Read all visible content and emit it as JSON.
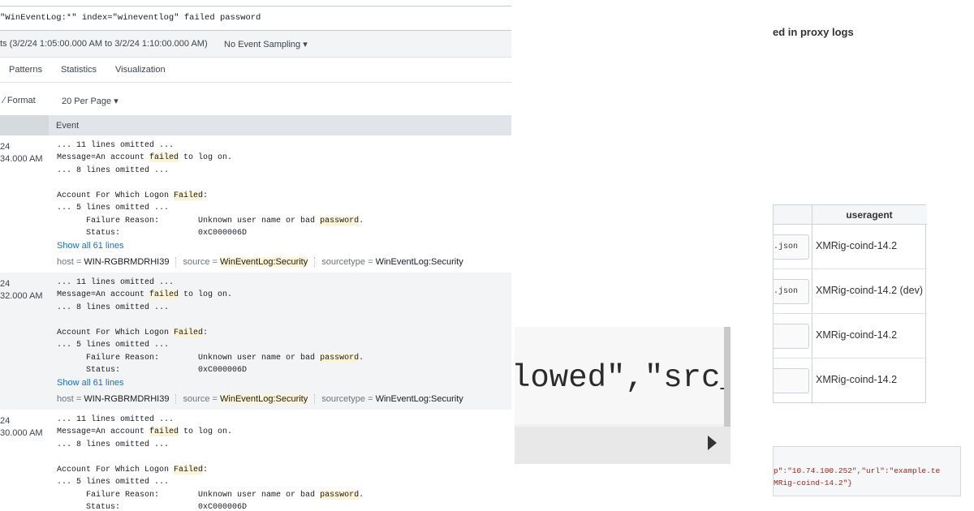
{
  "search": {
    "query": "\"WinEventLog:*\" index=\"wineventlog\" failed password"
  },
  "results_bar": {
    "count_suffix": "ts",
    "time_range": "(3/2/24 1:05:00.000 AM to 3/2/24 1:10:00.000 AM)",
    "sampling": "No Event Sampling ▾"
  },
  "tabs": [
    "Patterns",
    "Statistics",
    "Visualization"
  ],
  "toolbar": {
    "format": "∕ Format",
    "per_page": "20 Per Page ▾"
  },
  "table": {
    "event_header": "Event"
  },
  "events": [
    {
      "time_a": "24",
      "time_b": "34.000 AM",
      "show_all": "Show all 61 lines",
      "host": "WIN-RGBRMDRHI39",
      "source": "WinEventLog:Security",
      "sourcetype": "WinEventLog:Security"
    },
    {
      "time_a": "24",
      "time_b": "32.000 AM",
      "show_all": "Show all 61 lines",
      "host": "WIN-RGBRMDRHI39",
      "source": "WinEventLog:Security",
      "sourcetype": "WinEventLog:Security"
    },
    {
      "time_a": "24",
      "time_b": "30.000 AM"
    }
  ],
  "event_lines": {
    "l1": "... 11 lines omitted ...",
    "l2a": "Message=An account ",
    "l2b": "failed",
    "l2c": " to log on.",
    "l3": "... 8 lines omitted ...",
    "l4a": "Account For Which Logon ",
    "l4b": "Failed",
    "l4c": ":",
    "l5": "... 5 lines omitted ...",
    "l6a": "      Failure Reason:        Unknown user name or bad ",
    "l6b": "password",
    "l6c": ".",
    "l7": "      Status:                0xC000006D"
  },
  "meta_labels": {
    "host": "host = ",
    "source": "source = ",
    "sourcetype": "sourcetype = "
  },
  "zoom": {
    "code": "lowed\",\"src_"
  },
  "right": {
    "heading": "ed in proxy logs",
    "table_header": "useragent",
    "rows": [
      {
        "btn": ".json",
        "ua": "XMRig-coind-14.2"
      },
      {
        "btn": ".json",
        "ua": "XMRig-coind-14.2 (dev)"
      },
      {
        "btn": "",
        "ua": "XMRig-coind-14.2"
      },
      {
        "btn": "",
        "ua": "XMRig-coind-14.2"
      }
    ],
    "json_line1": "p\":\"10.74.100.252\",\"url\":\"example.te",
    "json_line2": "MRig-coind-14.2\"}"
  }
}
